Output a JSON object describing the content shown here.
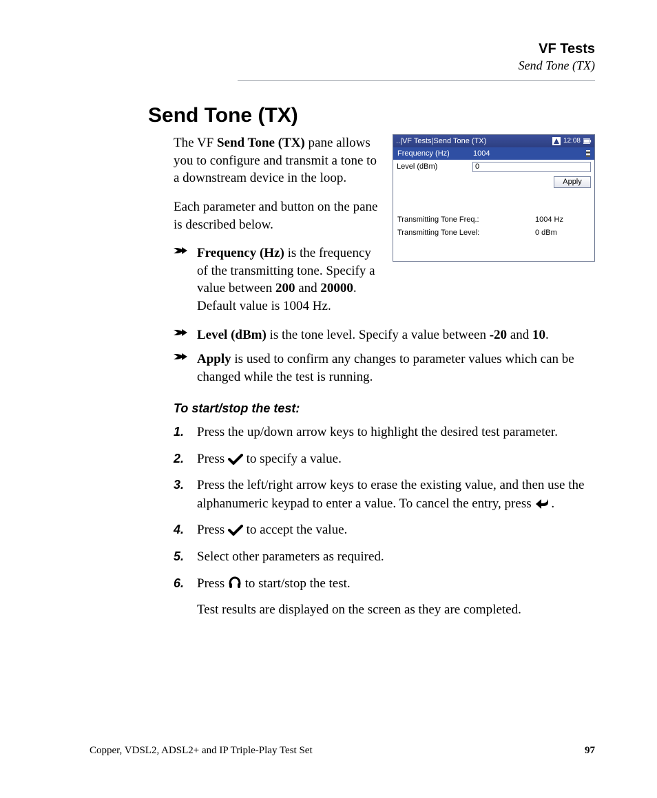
{
  "header": {
    "title": "VF Tests",
    "subtitle": "Send Tone (TX)"
  },
  "section_title": "Send Tone (TX)",
  "intro": {
    "p1a": "The VF ",
    "p1b": "Send Tone (TX)",
    "p1c": " pane allows you to configure and transmit a tone to a downstream device in the loop.",
    "p2": "Each parameter and button on the pane is described below."
  },
  "device": {
    "title": "..|VF Tests|Send Tone (TX)",
    "time": "12:08",
    "row_freq_label": "Frequency (Hz)",
    "row_freq_value": "1004",
    "row_level_label": "Level (dBm)",
    "row_level_value": "0",
    "apply_label": "Apply",
    "result_freq_label": "Transmitting Tone Freq.:",
    "result_freq_value": "1004 Hz",
    "result_level_label": "Transmitting Tone Level:",
    "result_level_value": "0 dBm"
  },
  "bullets": {
    "b1_label": "Frequency (Hz)",
    "b1_text_a": " is the frequency of the transmitting tone. Specify a value between ",
    "b1_v1": "200",
    "b1_and": " and ",
    "b1_v2": "20000",
    "b1_text_b": ". Default value is 1004 Hz.",
    "b2_label": "Level (dBm)",
    "b2_text_a": " is the tone level. Specify a value between ",
    "b2_v1": "-20",
    "b2_and": " and ",
    "b2_v2": "10",
    "b2_text_b": ".",
    "b3_label": "Apply",
    "b3_text": " is used to confirm any changes to parameter values which can be changed while the test is running."
  },
  "subhead": "To start/stop the test:",
  "steps": {
    "n1": "1.",
    "s1": "Press the up/down arrow keys to highlight the desired test parameter.",
    "n2": "2.",
    "s2a": "Press ",
    "s2b": " to specify a value.",
    "n3": "3.",
    "s3a": "Press the left/right arrow keys to erase the existing value, and then use the alphanumeric keypad to enter a value. To cancel the entry, press ",
    "s3b": ".",
    "n4": "4.",
    "s4a": "Press ",
    "s4b": " to accept the value.",
    "n5": "5.",
    "s5": "Select other parameters as required.",
    "n6": "6.",
    "s6a": "Press ",
    "s6b": " to start/stop the test.",
    "s6_note": "Test results are displayed on the screen as they are completed."
  },
  "footer": {
    "left": "Copper, VDSL2, ADSL2+ and IP Triple-Play Test Set",
    "page": "97"
  }
}
